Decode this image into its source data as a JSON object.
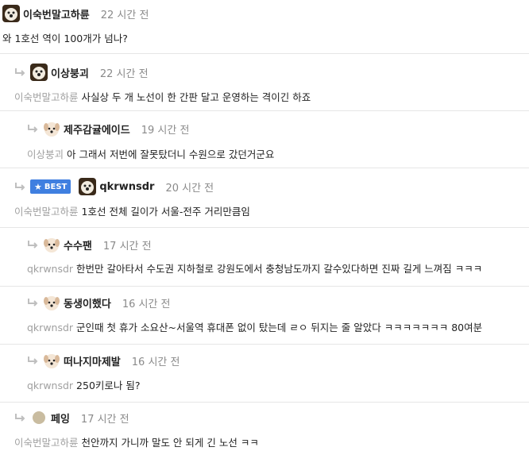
{
  "comments": [
    {
      "author": "이숙번말고하륜",
      "time": "22 시간 전",
      "mention": "",
      "text": "와 1호선 역이 100개가 넘나?",
      "best": false,
      "avatar": "dog-avatar"
    },
    {
      "author": "이상붕괴",
      "time": "22 시간 전",
      "mention": "이숙번말고하륜",
      "text": "사실상 두 개 노선이 한 간판 달고 운영하는 격이긴 하죠",
      "best": false,
      "avatar": "dog-avatar"
    },
    {
      "author": "제주감귤에이드",
      "time": "19 시간 전",
      "mention": "이상붕괴",
      "text": "아 그래서 저번에 잘못탔더니 수원으로 갔던거군요",
      "best": false,
      "avatar": "puppy-avatar"
    },
    {
      "author": "qkrwnsdr",
      "time": "20 시간 전",
      "mention": "이숙번말고하륜",
      "text": "1호선 전체 길이가 서울-전주 거리만큼임",
      "best": true,
      "best_label": "BEST",
      "avatar": "dog-avatar"
    },
    {
      "author": "수수팬",
      "time": "17 시간 전",
      "mention": "qkrwnsdr",
      "text": "한번만 갈아타서 수도권 지하철로 강원도에서 충청남도까지 갈수있다하면 진짜 길게 느껴짐 ㅋㅋㅋ",
      "best": false,
      "avatar": "puppy-avatar"
    },
    {
      "author": "동생이했다",
      "time": "16 시간 전",
      "mention": "qkrwnsdr",
      "text": "군인때 첫 휴가 소요산~서울역 휴대폰 없이 탔는데 ㄹㅇ 뒤지는 줄 알았다 ㅋㅋㅋㅋㅋㅋㅋ 80여분",
      "best": false,
      "avatar": "puppy-avatar"
    },
    {
      "author": "떠나지마제발",
      "time": "16 시간 전",
      "mention": "qkrwnsdr",
      "text": "250키로나 됨?",
      "best": false,
      "avatar": "puppy-avatar"
    },
    {
      "author": "페잉",
      "time": "17 시간 전",
      "mention": "이숙번말고하륜",
      "text": "천안까지 가니까 말도 안 되게 긴 노선 ㅋㅋ",
      "best": false,
      "avatar": "default-avatar"
    }
  ]
}
